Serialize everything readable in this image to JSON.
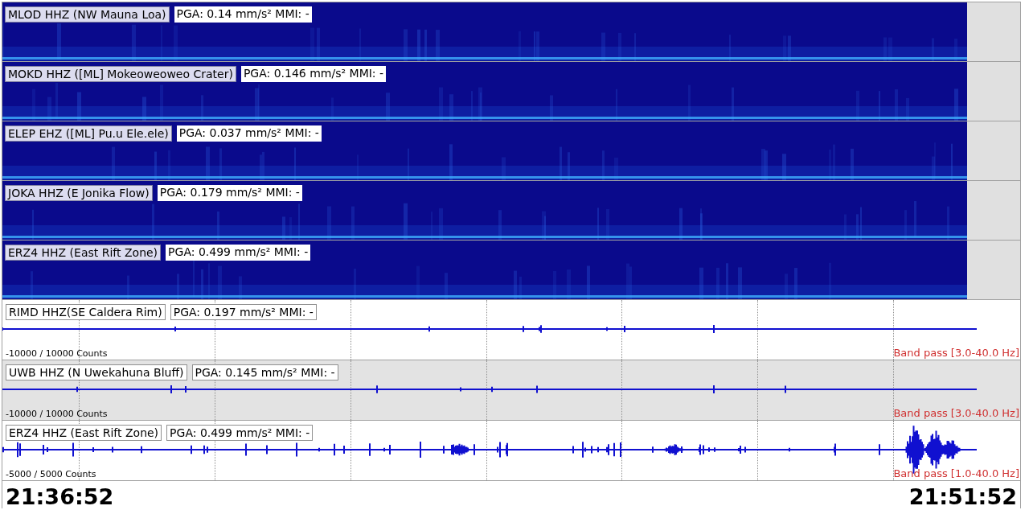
{
  "spectrograms": [
    {
      "station": "MLOD HHZ (NW Mauna Loa)",
      "pga": "PGA: 0.14 mm/s² MMI: -"
    },
    {
      "station": "MOKD HHZ ([ML] Mokeoweoweo Crater)",
      "pga": "PGA: 0.146 mm/s² MMI: -"
    },
    {
      "station": "ELEP EHZ ([ML] Pu.u Ele.ele)",
      "pga": "PGA: 0.037 mm/s² MMI: -"
    },
    {
      "station": "JOKA HHZ (E Jonika Flow)",
      "pga": "PGA: 0.179 mm/s² MMI: -"
    },
    {
      "station": "ERZ4 HHZ (East Rift Zone)",
      "pga": "PGA: 0.499 mm/s² MMI: -"
    }
  ],
  "waveforms": [
    {
      "station": "RIMD HHZ(SE Caldera Rim)",
      "pga": "PGA: 0.197 mm/s² MMI: -",
      "scale": "-10000 / 10000 Counts",
      "filter": "Band pass [3.0-40.0 Hz]",
      "selected": false
    },
    {
      "station": "UWB HHZ (N Uwekahuna Bluff)",
      "pga": "PGA: 0.145 mm/s² MMI: -",
      "scale": "-10000 / 10000 Counts",
      "filter": "Band pass [3.0-40.0 Hz]",
      "selected": true
    },
    {
      "station": "ERZ4 HHZ (East Rift Zone)",
      "pga": "PGA: 0.499 mm/s² MMI: -",
      "scale": "-5000 / 5000 Counts",
      "filter": "Band pass [1.0-40.0 Hz]",
      "selected": false
    }
  ],
  "time_axis": {
    "start": "21:36:52",
    "end": "21:51:52"
  }
}
